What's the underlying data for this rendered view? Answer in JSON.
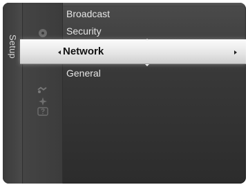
{
  "menu": {
    "section_label": "Setup",
    "items": [
      {
        "label": "Broadcast"
      },
      {
        "label": "Security"
      },
      {
        "label": "Network"
      },
      {
        "label": "General"
      }
    ],
    "selected_index": 2
  },
  "icons": [
    "disc-icon",
    "gear-icon",
    "satellite-icon",
    "sparkle-icon",
    "help-icon"
  ],
  "colors": {
    "panel": "#3a3a3a",
    "text": "#e6e6e6",
    "highlight": "#e6e6e6",
    "highlight_text": "#111111"
  }
}
